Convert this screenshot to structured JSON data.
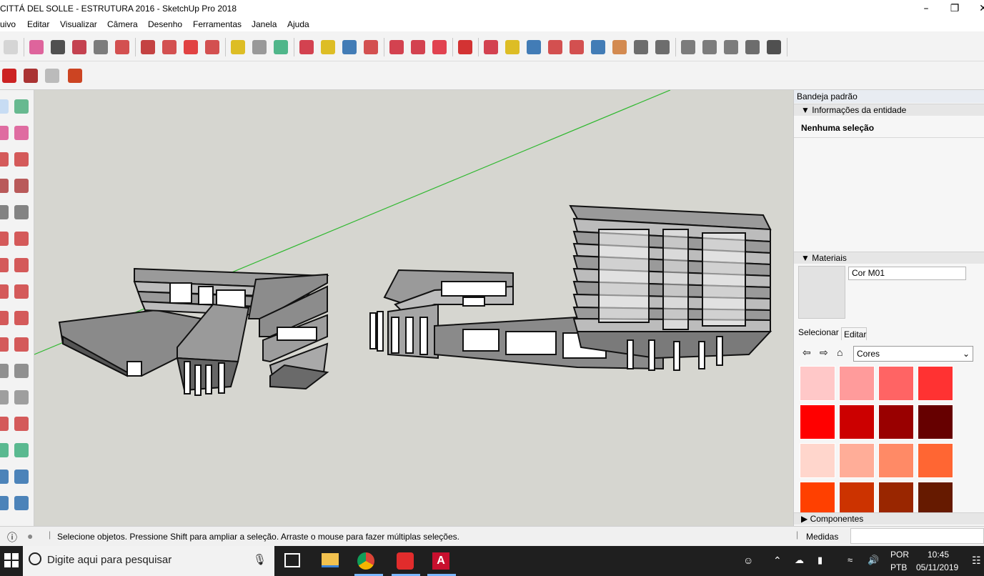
{
  "window": {
    "title": "CITTÁ DEL SOLLE - ESTRUTURA 2016 - SketchUp Pro 2018",
    "minimize_icon": "minimize-icon",
    "maximize_icon": "maximize-icon",
    "close_icon": "close-icon"
  },
  "menu": {
    "items": [
      "uivo",
      "Editar",
      "Visualizar",
      "Câmera",
      "Desenho",
      "Ferramentas",
      "Janela",
      "Ajuda"
    ]
  },
  "toolbar": {
    "icons": [
      "select-icon",
      "eraser-icon",
      "pencil-icon",
      "arc-icon",
      "rectangle-icon",
      "push-pull-icon",
      "follow-me-icon",
      "move-icon",
      "rotate-icon",
      "scale-icon",
      "tape-measure-icon",
      "text-icon",
      "paint-bucket-icon",
      "orbit-icon",
      "pan-icon",
      "zoom-icon",
      "zoom-extents-icon",
      "warehouse-icon",
      "extension-icon",
      "layout-icon",
      "ruby-icon",
      "orbit-icon",
      "pan-icon",
      "zoom-icon",
      "zoom-window-icon",
      "zoom-extents-icon",
      "previous-view-icon",
      "walk-icon",
      "look-around-icon",
      "footprints-icon",
      "iso-view-icon",
      "front-view-icon",
      "home-view-icon",
      "top-view-icon",
      "house-icon"
    ]
  },
  "tray": {
    "title": "Bandeja padrão",
    "entity_info": {
      "header": "Informações da entidade",
      "selection": "Nenhuma seleção"
    },
    "materials": {
      "header": "Materiais",
      "material_name": "Cor M01",
      "tab_select": "Selecionar",
      "tab_edit": "Editar",
      "library": "Cores",
      "swatches": [
        "#ffc8c8",
        "#ff9b9b",
        "#ff6464",
        "#ff3232",
        "#ff0000",
        "#cc0000",
        "#990000",
        "#660000",
        "#ffd6cc",
        "#ffad98",
        "#ff8a66",
        "#ff6633",
        "#ff4000",
        "#cc3300",
        "#992600",
        "#661a00"
      ]
    },
    "components": {
      "header": "Componentes"
    }
  },
  "status": {
    "message": "Selecione objetos. Pressione Shift para ampliar a seleção. Arraste o mouse para fazer múltiplas seleções.",
    "measures_label": "Medidas",
    "measures_value": ""
  },
  "taskbar": {
    "search_placeholder": "Digite aqui para pesquisar",
    "lang_primary": "POR",
    "lang_secondary": "PTB",
    "time": "10:45",
    "date": "05/11/2019"
  },
  "colors": {
    "viewport_bg": "#d6d6d0",
    "axis_green": "#2fb82f",
    "taskbar_bg": "#1f1f1f"
  }
}
